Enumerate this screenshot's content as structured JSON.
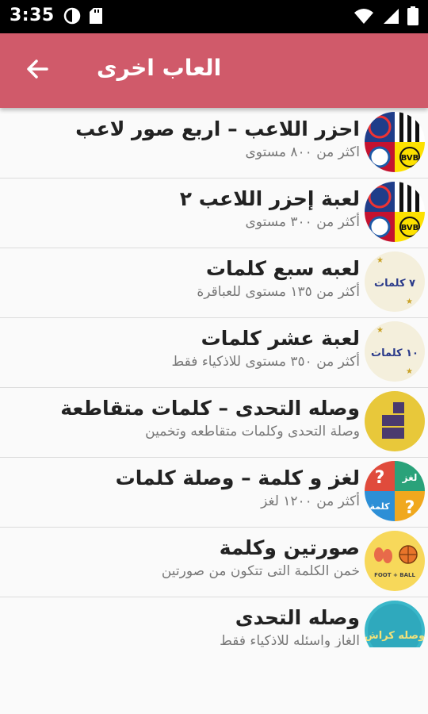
{
  "status_bar": {
    "time": "3:35"
  },
  "app_bar": {
    "title": "العاب اخرى"
  },
  "games": [
    {
      "title": "احزر اللاعب – اربع صور لاعب",
      "subtitle": "اكثر من ٨٠٠ مستوى"
    },
    {
      "title": "لعبة إحزر اللاعب ٢",
      "subtitle": "أكثر من ٣٠٠ مستوى"
    },
    {
      "title": "لعبه سبع كلمات",
      "subtitle": "أكثر من ١٣٥ مستوى للعباقرة",
      "icon_text": "٧ كلمات"
    },
    {
      "title": "لعبة عشر كلمات",
      "subtitle": "أكثر من ٣٥٠ مستوى للاذكياء فقط",
      "icon_text": "١٠ كلمات"
    },
    {
      "title": "وصله التحدى – كلمات متقاطعة",
      "subtitle": "وصلة التحدى وكلمات متقاطعه وتخمين"
    },
    {
      "title": "لغز و كلمة – وصلة كلمات",
      "subtitle": "أكثر من ١٢٠٠ لغز",
      "icon_text_top": "لغز",
      "icon_text_bottom": "كلمة"
    },
    {
      "title": "صورتين وكلمة",
      "subtitle": "خمن الكلمة التى تتكون من صورتين",
      "icon_text": "FOOT + BALL"
    },
    {
      "title": "وصله التحدى",
      "subtitle": "الغاز واسئله للاذكياء فقط",
      "icon_text": "وصله كراش"
    }
  ]
}
